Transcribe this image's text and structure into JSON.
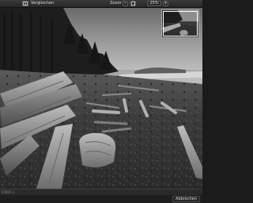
{
  "toolbar": {
    "compare_label": "Vergleichen",
    "zoom_label": "Zoom",
    "zoom_value": "25%",
    "zoom_minus": "−",
    "zoom_plus": "+"
  },
  "status": {
    "text": "ICM25-1"
  },
  "footer": {
    "cancel_label": "Abbrechen"
  }
}
